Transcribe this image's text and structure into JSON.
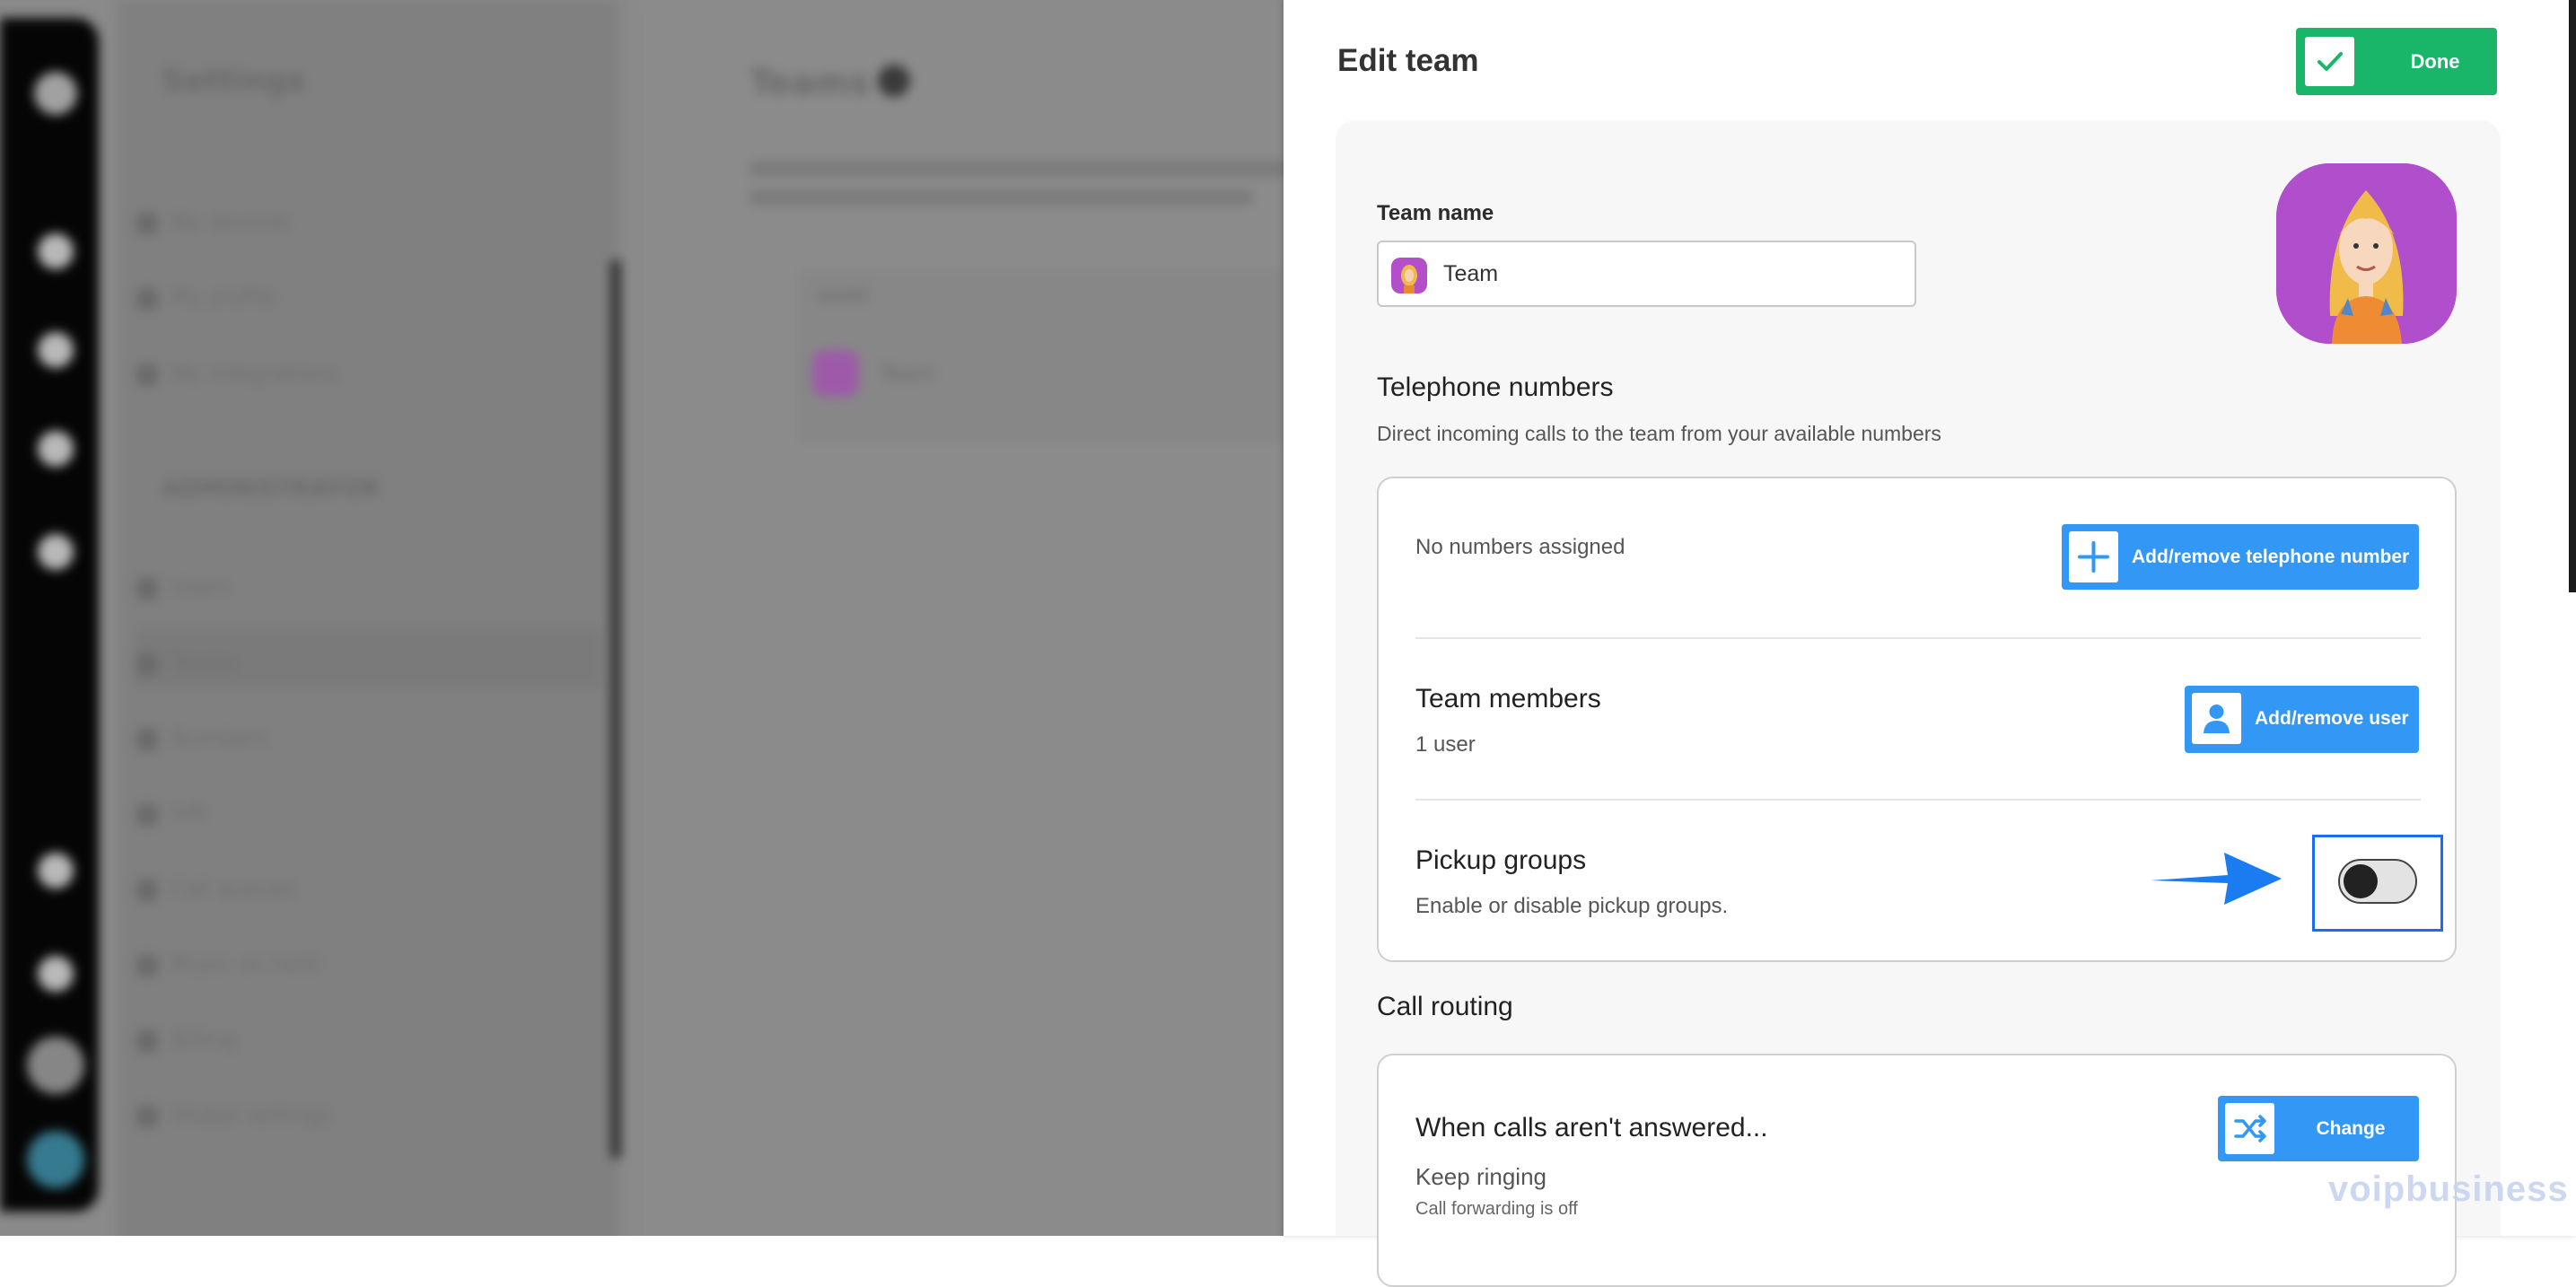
{
  "background": {
    "settings_title": "Settings",
    "teams_title": "Teams",
    "admin_section": "ADMINISTRATOR",
    "personal_items": [
      "My devices",
      "My profile",
      "My integrations"
    ],
    "admin_items": [
      "Users",
      "Teams",
      "Numbers",
      "IVR",
      "Call queues",
      "Music on hold",
      "Billing",
      "Global settings"
    ],
    "table_header": "NAME",
    "table_row": "Team"
  },
  "panel": {
    "title": "Edit team",
    "done_label": "Done",
    "team_name_label": "Team name",
    "team_name_value": "Team",
    "telephone": {
      "heading": "Telephone numbers",
      "description": "Direct incoming calls to the team from your available numbers",
      "status": "No numbers assigned",
      "button_label": "Add/remove telephone number"
    },
    "members": {
      "heading": "Team members",
      "count": "1 user",
      "button_label": "Add/remove user"
    },
    "pickup": {
      "heading": "Pickup groups",
      "description": "Enable or disable pickup groups.",
      "enabled": false
    },
    "routing": {
      "heading": "Call routing",
      "when_label": "When calls aren't answered...",
      "behavior": "Keep ringing",
      "forwarding": "Call forwarding is off",
      "button_label": "Change"
    }
  },
  "watermark": "voipbusiness",
  "colors": {
    "done_green": "#19b568",
    "action_blue": "#3297f5",
    "highlight_blue": "#1a6cf5",
    "avatar_purple": "#b04ecc",
    "arrow_blue": "#1a7cf0"
  }
}
